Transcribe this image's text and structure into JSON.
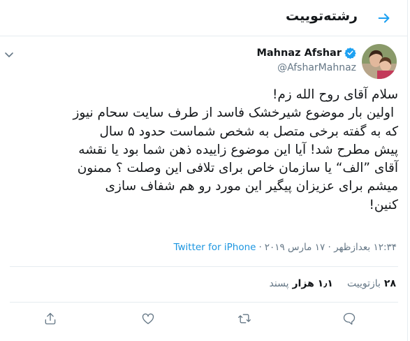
{
  "header": {
    "title": "رشته‌توییت",
    "back_icon": "back-arrow-icon"
  },
  "accent_color": "#1da1f2",
  "tweet": {
    "author": {
      "display_name": "Mahnaz Afshar",
      "handle": "@AfsharMahnaz",
      "verified": true
    },
    "text": "سلام آقای روح الله زم!\n اولین بار موضوع شیرخشک فاسد از طرف سایت سحام نیوز\nکه به گفته برخی متصل به شخص شماست حدود ۵ سال\nپیش مطرح شد! آیا این موضوع زاییده ذهن شما بود یا نقشه\nآقای ”الف“ یا سازمان خاص برای تلافی این وصلت ؟ ممنون\nمیشم برای عزیزان پیگیر این مورد رو هم شفاف سازی\nکنین!",
    "timestamp": "۱۲:۳۴ بعدازظهر · ۱۷ مارس ۲۰۱۹",
    "separator": "·",
    "source": "Twitter for iPhone",
    "stats": {
      "retweets_count": "۲۸",
      "retweets_label": "بازتوییت",
      "likes_count": "۱٫۱ هزار",
      "likes_label": "پسند"
    }
  },
  "actions": [
    "reply-icon",
    "retweet-icon",
    "like-icon",
    "share-icon"
  ]
}
